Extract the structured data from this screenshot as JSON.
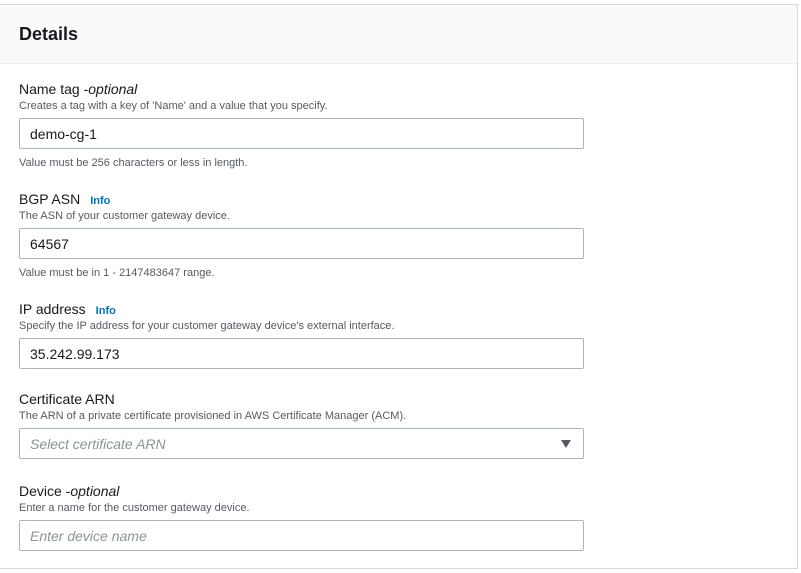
{
  "section": {
    "title": "Details"
  },
  "fields": {
    "name_tag": {
      "label": "Name tag - ",
      "optional": "optional",
      "description": "Creates a tag with a key of 'Name' and a value that you specify.",
      "value": "demo-cg-1",
      "constraint": "Value must be 256 characters or less in length."
    },
    "bgp_asn": {
      "label": "BGP ASN",
      "info": "Info",
      "description": "The ASN of your customer gateway device.",
      "value": "64567",
      "constraint": "Value must be in 1 - 2147483647 range."
    },
    "ip_address": {
      "label": "IP address",
      "info": "Info",
      "description": "Specify the IP address for your customer gateway device's external interface.",
      "value": "35.242.99.173"
    },
    "certificate_arn": {
      "label": "Certificate ARN",
      "description": "The ARN of a private certificate provisioned in AWS Certificate Manager (ACM).",
      "placeholder": "Select certificate ARN"
    },
    "device": {
      "label": "Device - ",
      "optional": "optional",
      "description": "Enter a name for the customer gateway device.",
      "placeholder": "Enter device name"
    }
  },
  "icons": {
    "select_caret": "caret-down-icon"
  }
}
